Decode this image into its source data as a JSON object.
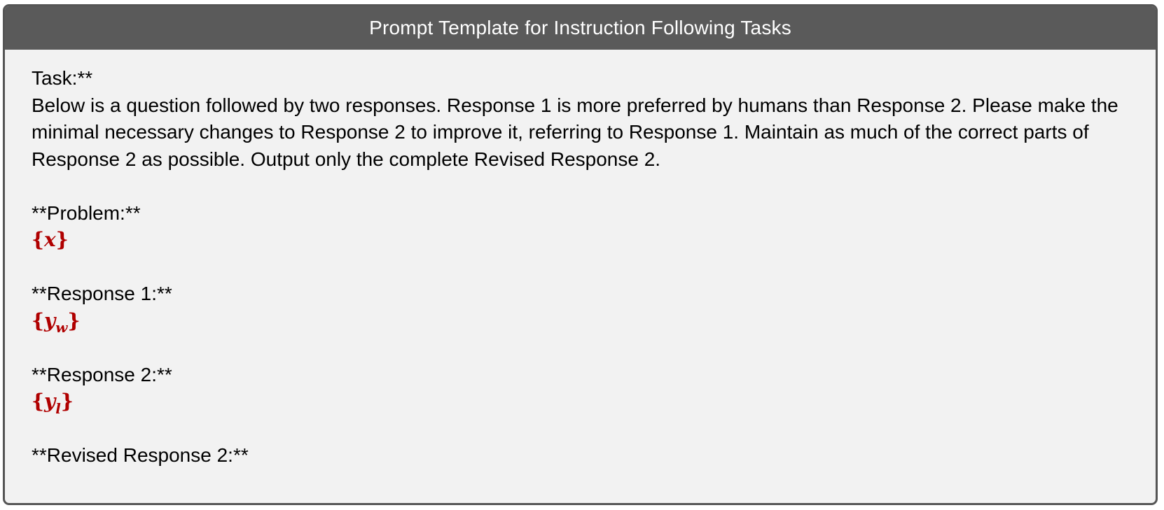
{
  "header": {
    "title": "Prompt Template for Instruction Following Tasks"
  },
  "body": {
    "task_label": "Task:**",
    "task_text": "Below is a question followed by two responses. Response 1 is more preferred by humans than Response 2. Please make the minimal necessary changes to Response 2 to improve it, referring to Response 1. Maintain as much of the correct parts of Response 2 as possible. Output only the complete Revised Response 2.",
    "problem_label": "**Problem:**",
    "problem_var": {
      "open": "{",
      "symbol": "x",
      "sub": "",
      "close": "}"
    },
    "response1_label": "**Response 1:**",
    "response1_var": {
      "open": "{",
      "symbol": "y",
      "sub": "w",
      "close": "}"
    },
    "response2_label": "**Response 2:**",
    "response2_var": {
      "open": "{",
      "symbol": "y",
      "sub": "l",
      "close": "}"
    },
    "revised_label": "**Revised Response 2:**"
  },
  "colors": {
    "header_bg": "#5a5a5a",
    "body_bg": "#f2f2f2",
    "border": "#555555",
    "variable": "#b00000"
  }
}
